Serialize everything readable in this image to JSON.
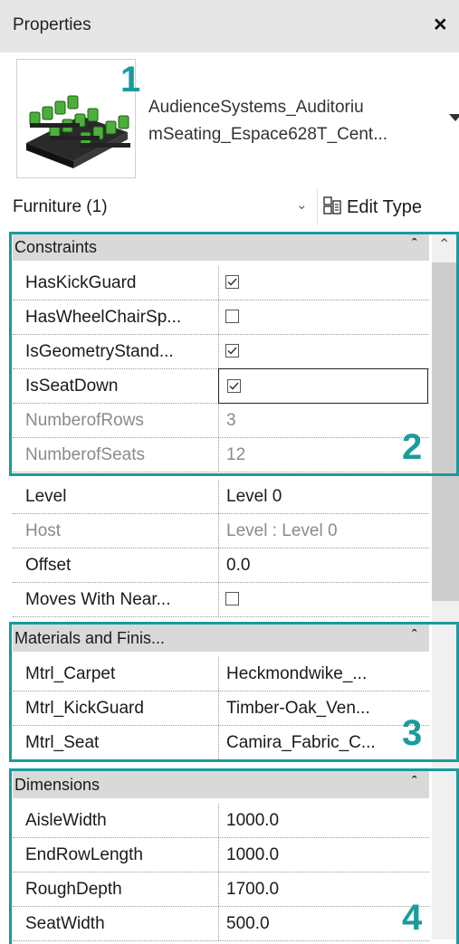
{
  "panel": {
    "title": "Properties",
    "close_glyph": "×"
  },
  "type_selector": {
    "name_line1": "AudienceSystems_Auditoriu",
    "name_line2": "mSeating_Espace628T_Cent..."
  },
  "filter": {
    "label": "Furniture (1)",
    "edit_type_label": "Edit Type"
  },
  "groups": {
    "constraints": {
      "label": "Constraints",
      "rows": [
        {
          "name": "HasKickGuard",
          "checked": true
        },
        {
          "name": "HasWheelChairSp...",
          "checked": false
        },
        {
          "name": "IsGeometryStand...",
          "checked": true
        },
        {
          "name": "IsSeatDown",
          "checked": true
        },
        {
          "name": "NumberofRows",
          "value": "3"
        },
        {
          "name": "NumberofSeats",
          "value": "12"
        },
        {
          "name": "Level",
          "value": "Level 0"
        },
        {
          "name": "Host",
          "value": "Level : Level 0"
        },
        {
          "name": "Offset",
          "value": "0.0"
        },
        {
          "name": "Moves With Near...",
          "checked": false
        }
      ]
    },
    "materials": {
      "label": "Materials and Finis...",
      "rows": [
        {
          "name": "Mtrl_Carpet",
          "value": "Heckmondwike_..."
        },
        {
          "name": "Mtrl_KickGuard",
          "value": "Timber-Oak_Ven..."
        },
        {
          "name": "Mtrl_Seat",
          "value": "Camira_Fabric_C..."
        }
      ]
    },
    "dimensions": {
      "label": "Dimensions",
      "rows": [
        {
          "name": "AisleWidth",
          "value": "1000.0"
        },
        {
          "name": "EndRowLength",
          "value": "1000.0"
        },
        {
          "name": "RoughDepth",
          "value": "1700.0"
        },
        {
          "name": "SeatWidth",
          "value": "500.0"
        }
      ]
    }
  },
  "callouts": [
    "1",
    "2",
    "3",
    "4"
  ],
  "colors": {
    "callout": "#1a9b9c",
    "group_header": "#d9d9d9",
    "title_bar": "#e6e6e6"
  }
}
